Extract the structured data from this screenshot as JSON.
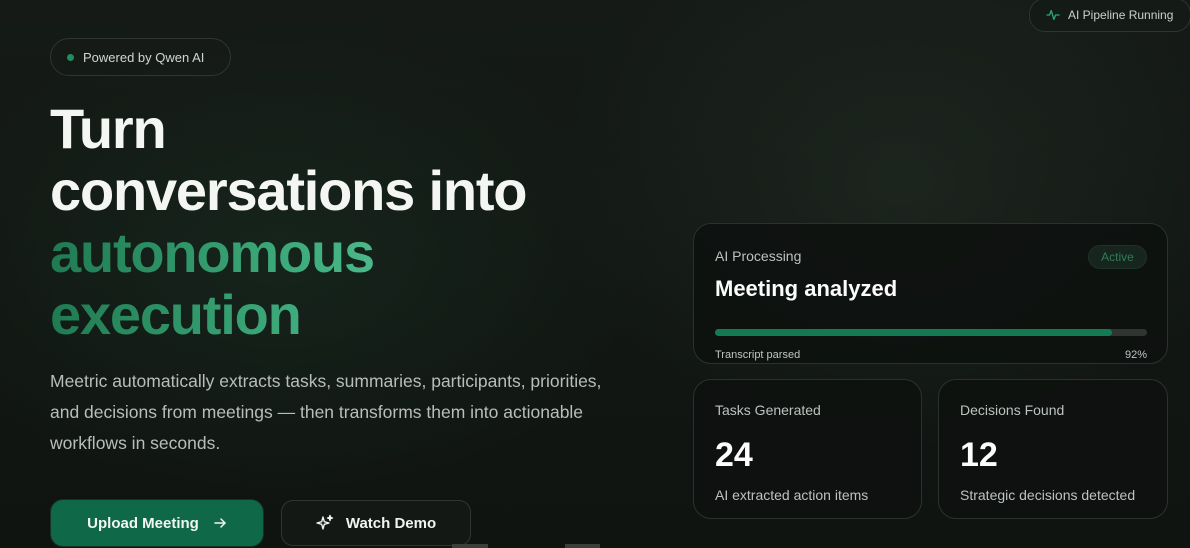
{
  "status_pill": {
    "label": "AI Pipeline Running",
    "icon": "activity-icon"
  },
  "badge": {
    "label": "Powered by Qwen AI"
  },
  "hero": {
    "title_line1": "Turn",
    "title_line2": "conversations into",
    "title_accent1": "autonomous",
    "title_accent2": "execution",
    "description": "Meetric automatically extracts tasks, summaries, participants, priorities, and decisions from meetings — then transforms them into actionable workflows in seconds."
  },
  "buttons": {
    "upload": "Upload Meeting",
    "watch": "Watch Demo"
  },
  "processing_card": {
    "label": "AI Processing",
    "badge": "Active",
    "title": "Meeting analyzed",
    "progress_label": "Transcript parsed",
    "progress_value": "92%",
    "progress_fraction": 0.92
  },
  "tasks_card": {
    "label": "Tasks Generated",
    "value": "24",
    "sub": "AI extracted action items"
  },
  "decisions_card": {
    "label": "Decisions Found",
    "value": "12",
    "sub": "Strategic decisions detected"
  },
  "colors": {
    "accent": "#0f6848",
    "accent_light": "#62d2a2",
    "progress": "#137a54",
    "background": "#121613"
  }
}
